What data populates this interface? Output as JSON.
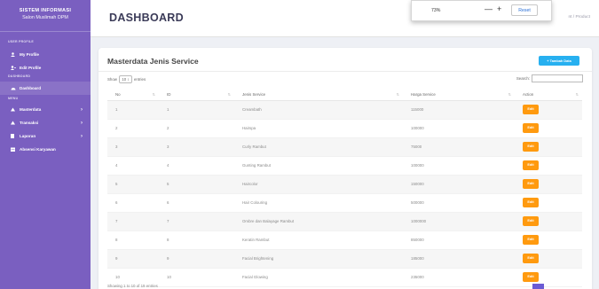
{
  "sidebar": {
    "brand_title": "SISTEM INFORMASI",
    "brand_subtitle": "Salon Muslimah DPM",
    "sections": {
      "user_profile": "USER PROFILE",
      "dashboard": "DASHBOARD",
      "menu": "MENU"
    },
    "items": [
      {
        "label": "My Profile",
        "icon": "user-icon"
      },
      {
        "label": "Edit Profile",
        "icon": "user-edit-icon"
      },
      {
        "label": "Dashboard",
        "icon": "dashboard-icon"
      },
      {
        "label": "Masterdata",
        "icon": "folder-icon"
      },
      {
        "label": "Transaksi",
        "icon": "folder-icon"
      },
      {
        "label": "Laporan",
        "icon": "file-icon"
      },
      {
        "label": "Absensi Karyawan",
        "icon": "calendar-icon"
      }
    ]
  },
  "header": {
    "title": "DASHBOARD",
    "breadcrumb": "nt / Product"
  },
  "zoom_popup": {
    "level": "73%",
    "minus": "—",
    "plus": "+",
    "reset_label": "Reset"
  },
  "card": {
    "title": "Masterdata Jenis Service",
    "add_button": "+ Tambah Data",
    "show_label": "Show",
    "entries_value": "10 ↕",
    "entries_label": "entries",
    "search_label": "Search:"
  },
  "table": {
    "columns": [
      "No",
      "ID",
      "Jenis Service",
      "Harga Service",
      "Action"
    ],
    "edit_label": "Edit",
    "rows": [
      {
        "no": "1",
        "id": "1",
        "service": "Creambath",
        "price": "115000"
      },
      {
        "no": "2",
        "id": "2",
        "service": "Hairspa",
        "price": "100000"
      },
      {
        "no": "3",
        "id": "3",
        "service": "Curly Rambut",
        "price": "75000"
      },
      {
        "no": "4",
        "id": "4",
        "service": "Gunting Rambut",
        "price": "100000"
      },
      {
        "no": "5",
        "id": "5",
        "service": "Haircolor",
        "price": "150000"
      },
      {
        "no": "6",
        "id": "6",
        "service": "Hair Colouring",
        "price": "500000"
      },
      {
        "no": "7",
        "id": "7",
        "service": "Ombre dan Balayage Rambut",
        "price": "1000000"
      },
      {
        "no": "8",
        "id": "8",
        "service": "Keratin Rambut",
        "price": "850000"
      },
      {
        "no": "9",
        "id": "9",
        "service": "Facial Brightening",
        "price": "185000"
      },
      {
        "no": "10",
        "id": "10",
        "service": "Facial Glowing",
        "price": "235000"
      }
    ]
  },
  "footer": {
    "info": "Showing 1 to 10 of 19 entries"
  },
  "colors": {
    "sidebar": "#7a5fc0",
    "add_button": "#27b0f0",
    "edit_button": "#ff9a0f"
  }
}
